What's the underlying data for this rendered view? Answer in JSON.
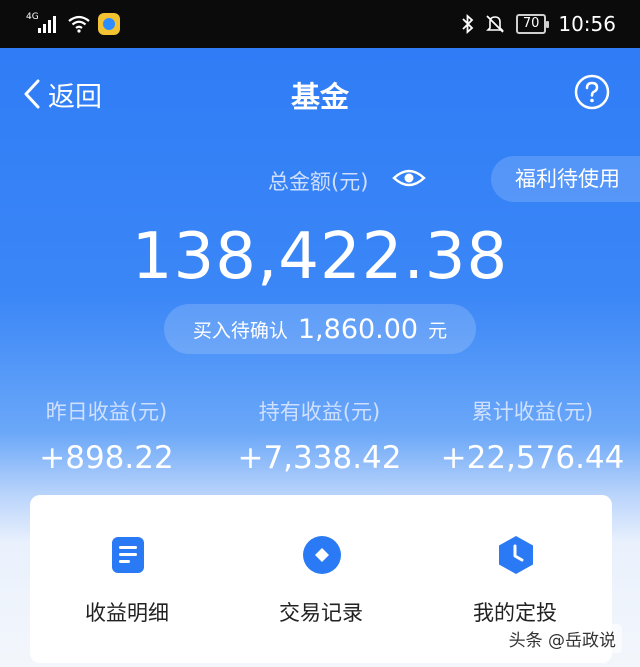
{
  "status_bar": {
    "network": "4G",
    "battery": "70",
    "time": "10:56"
  },
  "nav": {
    "back_label": "返回",
    "title": "基金"
  },
  "summary": {
    "total_label": "总金额(元)",
    "welfare_label": "福利待使用",
    "total_amount": "138,422.38",
    "pending_label": "买入待确认",
    "pending_amount": "1,860.00",
    "pending_unit": "元"
  },
  "stats": [
    {
      "label": "昨日收益(元)",
      "value": "+898.22"
    },
    {
      "label": "持有收益(元)",
      "value": "+7,338.42"
    },
    {
      "label": "累计收益(元)",
      "value": "+22,576.44"
    }
  ],
  "actions": [
    {
      "label": "收益明细",
      "icon": "document-icon"
    },
    {
      "label": "交易记录",
      "icon": "diamond-circle-icon"
    },
    {
      "label": "我的定投",
      "icon": "clock-hexagon-icon"
    }
  ],
  "watermark": "头条 @岳政说",
  "colors": {
    "primary": "#2f7cf6",
    "icon": "#2b7af5",
    "text_dark": "#222222"
  }
}
